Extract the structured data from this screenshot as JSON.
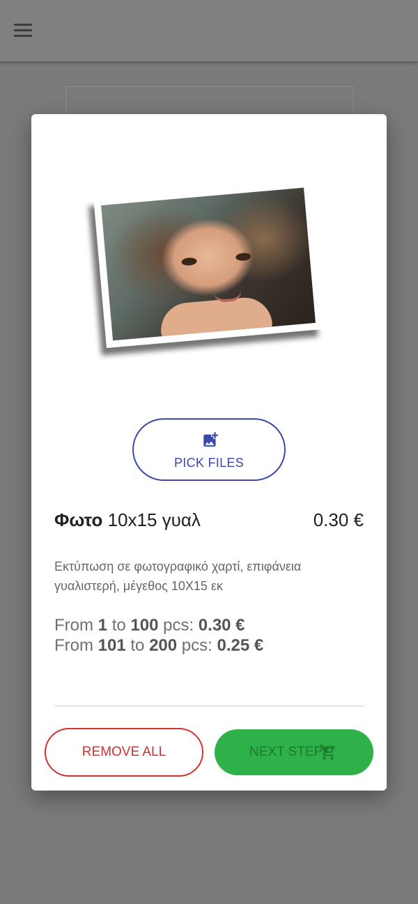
{
  "topbar": {
    "menu_icon": "hamburger-menu-icon"
  },
  "dialog": {
    "pick_files_label": "PICK FILES",
    "pick_files_icon": "add-photo-icon",
    "product": {
      "name_bold": "Φωτο",
      "name_rest": "10x15 γυαλ",
      "price": "0.30 €",
      "description": "Εκτύπωση σε φωτογραφικό χαρτί, επιφάνεια γυαλιστερή, μέγεθος 10Χ15 εκ"
    },
    "price_tiers": [
      {
        "from_word": "From",
        "from": "1",
        "to_word": "to",
        "to": "100",
        "unit": "pcs:",
        "price": "0.30 €"
      },
      {
        "from_word": "From",
        "from": "101",
        "to_word": "to",
        "to": "200",
        "unit": "pcs:",
        "price": "0.25 €"
      }
    ],
    "remove_all_label": "REMOVE ALL",
    "next_step_label": "NEXT STEP",
    "next_step_icon": "shopping-cart-icon"
  },
  "colors": {
    "primary_blue": "#3949ab",
    "danger_red": "#d32f2f",
    "success_green": "#2fb14a"
  }
}
